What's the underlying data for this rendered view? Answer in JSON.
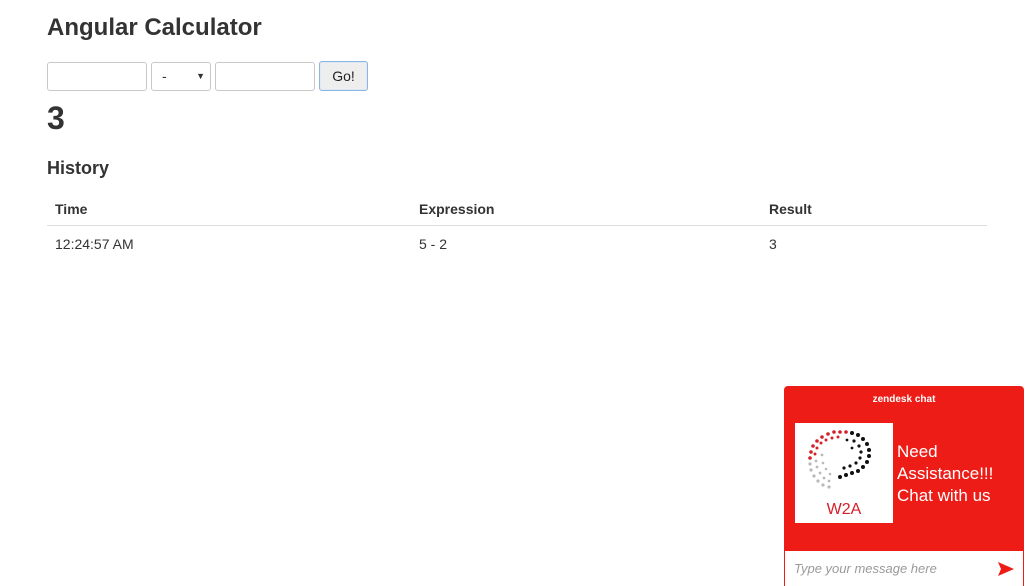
{
  "app": {
    "title": "Angular Calculator"
  },
  "calculator": {
    "first_value": "",
    "operator": "-",
    "second_value": "",
    "go_label": "Go!",
    "result": "3"
  },
  "history": {
    "heading": "History",
    "columns": [
      "Time",
      "Expression",
      "Result"
    ],
    "rows": [
      {
        "time": "12:24:57 AM",
        "expression": "5 - 2",
        "result": "3"
      }
    ]
  },
  "chat": {
    "header": "zendesk chat",
    "logo_text": "W2A",
    "greeting_line1": "Need",
    "greeting_line2": "Assistance!!!",
    "greeting_line3": "Chat with us",
    "input_placeholder": "Type your message here",
    "brand_color": "#ed1c16",
    "send_icon": "send-icon"
  }
}
